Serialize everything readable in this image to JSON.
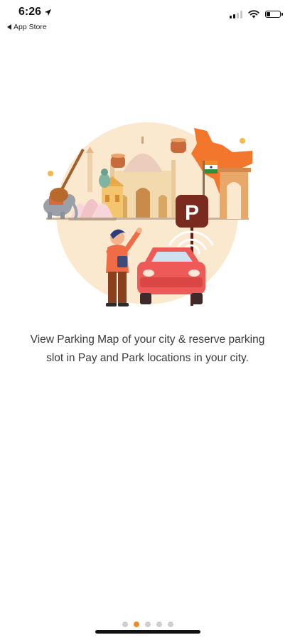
{
  "status_bar": {
    "time": "6:26",
    "back_label": "App Store",
    "battery_level": 0.3
  },
  "onboarding": {
    "description": "View Parking Map of your city & reserve parking slot in Pay and Park locations in your city.",
    "parking_sign_letter": "P"
  },
  "pager": {
    "total_pages": 5,
    "active_page": 2
  },
  "colors": {
    "accent": "#f08a2b",
    "car": "#ee5a57",
    "circle": "#fbe9cf",
    "sign": "#7a2a1e"
  },
  "icons": [
    "location-arrow-icon",
    "signal-icon",
    "wifi-icon",
    "battery-icon"
  ]
}
